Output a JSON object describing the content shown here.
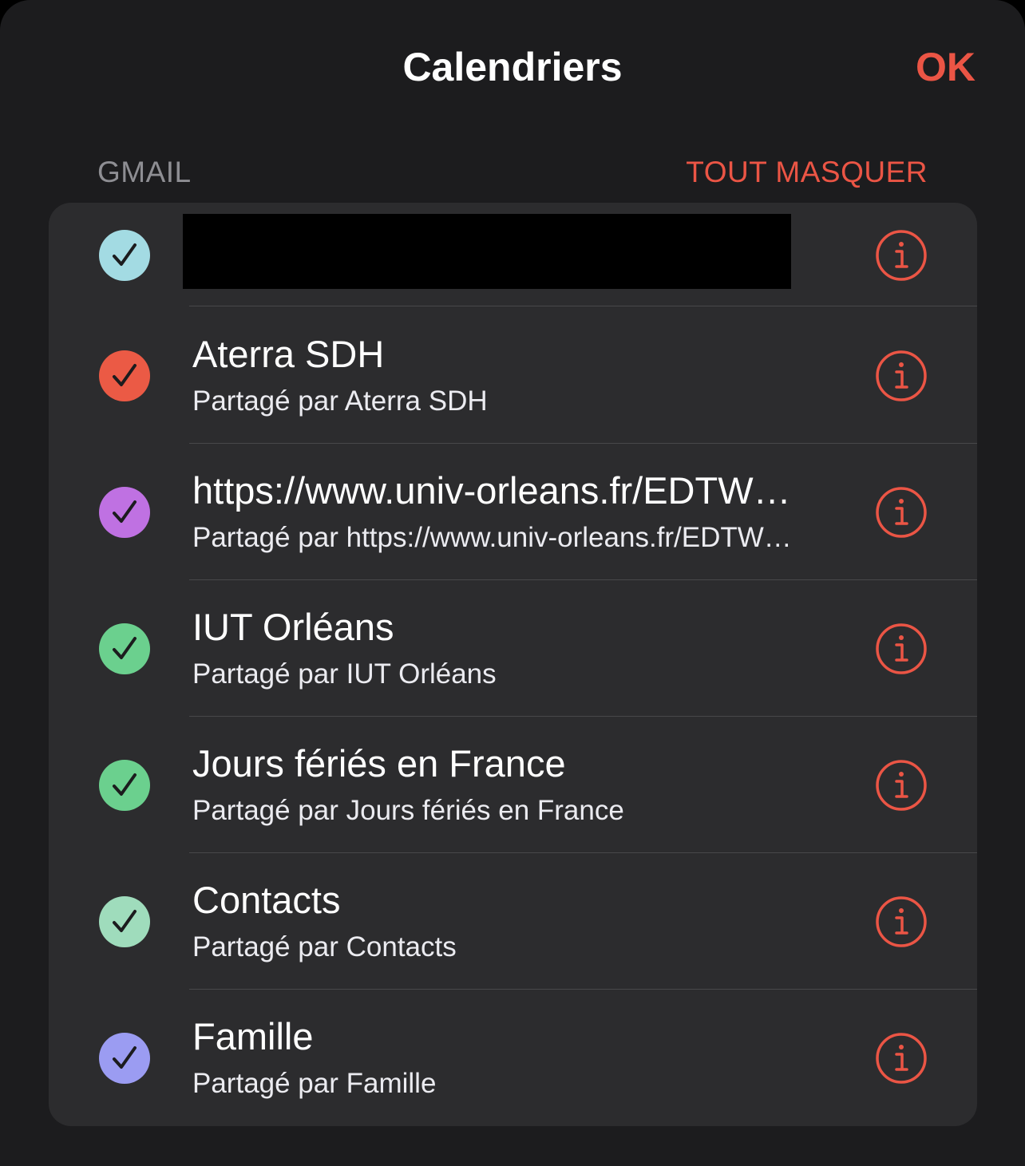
{
  "header": {
    "title": "Calendriers",
    "ok_label": "OK"
  },
  "section": {
    "label": "GMAIL",
    "hide_all_label": "TOUT MASQUER"
  },
  "colors": {
    "accent": "#eb5545",
    "background": "#1c1c1e",
    "group_background": "#2c2c2e"
  },
  "calendars": [
    {
      "title": "",
      "subtitle": "",
      "color": "#a3dbe3",
      "checked": true,
      "redacted": true
    },
    {
      "title": "Aterra SDH",
      "subtitle": "Partagé par Aterra SDH",
      "color": "#eb5a45",
      "checked": true
    },
    {
      "title": "https://www.univ-orleans.fr/EDTW…",
      "subtitle": "Partagé par https://www.univ-orleans.fr/EDTW…",
      "color": "#bf71e2",
      "checked": true
    },
    {
      "title": "IUT Orléans",
      "subtitle": "Partagé par IUT Orléans",
      "color": "#6bd08e",
      "checked": true
    },
    {
      "title": "Jours fériés en France",
      "subtitle": "Partagé par Jours fériés en France",
      "color": "#6bd08e",
      "checked": true
    },
    {
      "title": "Contacts",
      "subtitle": "Partagé par Contacts",
      "color": "#9fdcbc",
      "checked": true
    },
    {
      "title": "Famille",
      "subtitle": "Partagé par Famille",
      "color": "#9b9cf2",
      "checked": true
    }
  ]
}
